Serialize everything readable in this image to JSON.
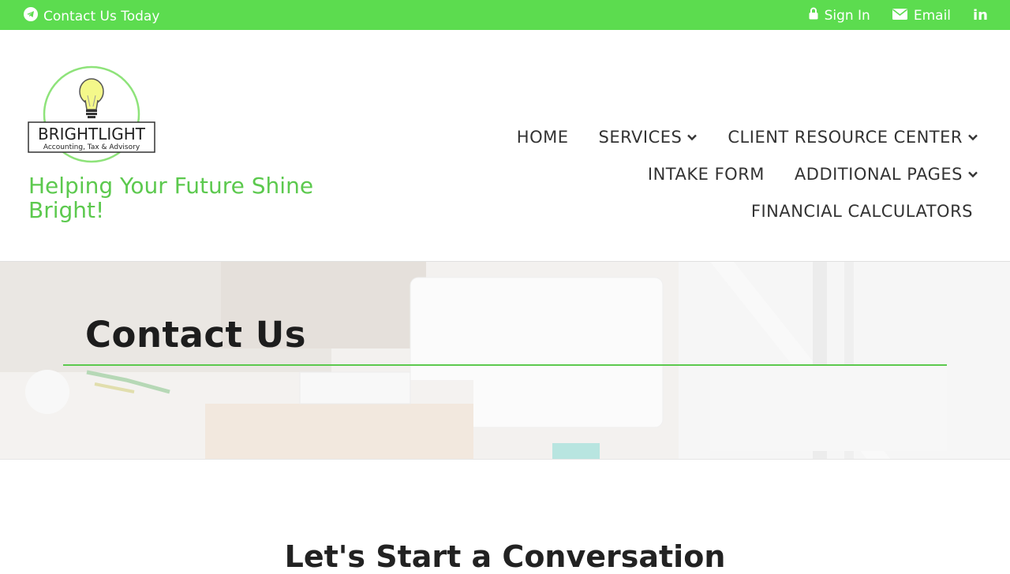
{
  "topbar": {
    "contact_label": "Contact Us Today",
    "signin_label": "Sign In",
    "email_label": "Email",
    "social_label": "in",
    "bg_color": "#5cdc4f"
  },
  "logo": {
    "brand_text": "BRIGHTLIGHT",
    "sub_text": "Accounting, Tax & Advisory"
  },
  "tagline": "Helping Your Future Shine Bright!",
  "nav": {
    "items": [
      {
        "label": "HOME"
      },
      {
        "label": "SERVICES"
      },
      {
        "label": "CLIENT RESOURCE CENTER"
      },
      {
        "label": "INTAKE FORM"
      },
      {
        "label": "ADDITIONAL PAGES"
      },
      {
        "label": "FINANCIAL CALCULATORS"
      }
    ]
  },
  "hero": {
    "title": "Contact Us",
    "accent": "#5cc94e"
  },
  "section": {
    "title": "Let's Start a Conversation"
  },
  "colors": {
    "brand_green": "#5cdc4f",
    "tagline_green": "#5cc94e",
    "text_dark": "#222222"
  }
}
